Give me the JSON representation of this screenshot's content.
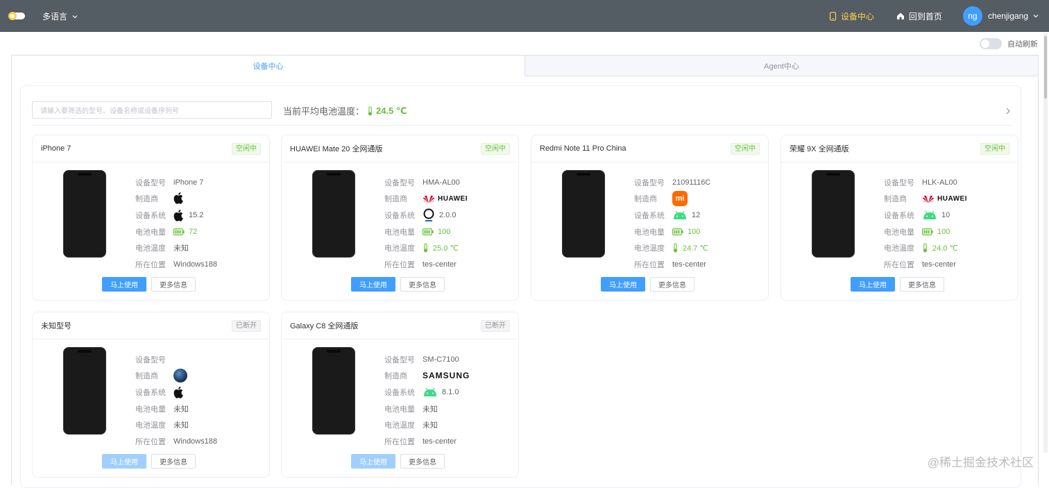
{
  "topbar": {
    "lang_label": "多语言",
    "device_center": "设备中心",
    "back_home": "回到首页",
    "user_initials": "ng",
    "username": "chenjigang"
  },
  "auto_refresh_label": "自动刷新",
  "tabs": [
    {
      "label": "设备中心"
    },
    {
      "label": "Agent中心"
    }
  ],
  "search": {
    "placeholder": "请输入要筛选的型号、设备名称或设备序列号"
  },
  "avg_temp": {
    "label": "当前平均电池温度：",
    "value": "24.5 ℃"
  },
  "labels": {
    "model": "设备型号",
    "maker": "制造商",
    "os": "设备系统",
    "battery": "电池电量",
    "temp": "电池温度",
    "location": "所在位置"
  },
  "buttons": {
    "use": "马上使用",
    "more": "更多信息"
  },
  "status": {
    "idle": "空闲中",
    "offline": "已断开"
  },
  "devices": [
    {
      "name": "iPhone 7",
      "status": "空闲中",
      "model": "iPhone 7",
      "maker_icon": "apple-logo",
      "os_icon": "apple-icon",
      "os_version": "15.2",
      "battery": "72",
      "temp": "未知",
      "location": "Windows188"
    },
    {
      "name": "HUAWEI Mate 20 全网通版",
      "status": "空闲中",
      "model": "HMA-AL00",
      "maker_icon": "huawei-logo",
      "maker_text": "HUAWEI",
      "os_icon": "harmony-os-icon",
      "os_version": "2.0.0",
      "battery": "100",
      "temp": "25.0 ℃",
      "location": "tes-center"
    },
    {
      "name": "Redmi Note 11 Pro China",
      "status": "空闲中",
      "model": "21091116C",
      "maker_icon": "xiaomi-logo",
      "maker_text": "mi",
      "os_icon": "android-icon",
      "os_version": "12",
      "battery": "100",
      "temp": "24.7 ℃",
      "location": "tes-center"
    },
    {
      "name": "荣耀 9X 全网通版",
      "status": "空闲中",
      "model": "HLK-AL00",
      "maker_icon": "huawei-logo",
      "maker_text": "HUAWEI",
      "os_icon": "android-icon",
      "os_version": "10",
      "battery": "100",
      "temp": "24.0 ℃",
      "location": "tes-center"
    },
    {
      "name": "未知型号",
      "status": "已断开",
      "model": "",
      "maker_icon": "globe-logo",
      "os_icon": "apple-icon",
      "os_version": "",
      "battery": "未知",
      "temp": "未知",
      "location": "Windows188"
    },
    {
      "name": "Galaxy C8 全网通版",
      "status": "已断开",
      "model": "SM-C7100",
      "maker_icon": "samsung-logo",
      "maker_text": "SAMSUNG",
      "os_icon": "android-icon",
      "os_version": "8.1.0",
      "battery": "未知",
      "temp": "未知",
      "location": "tes-center"
    }
  ],
  "watermark": "@稀土掘金技术社区",
  "colors": {
    "topbar": "#545c64",
    "primary": "#409eff",
    "success": "#67c23a",
    "active_nav": "#ffd04b"
  }
}
